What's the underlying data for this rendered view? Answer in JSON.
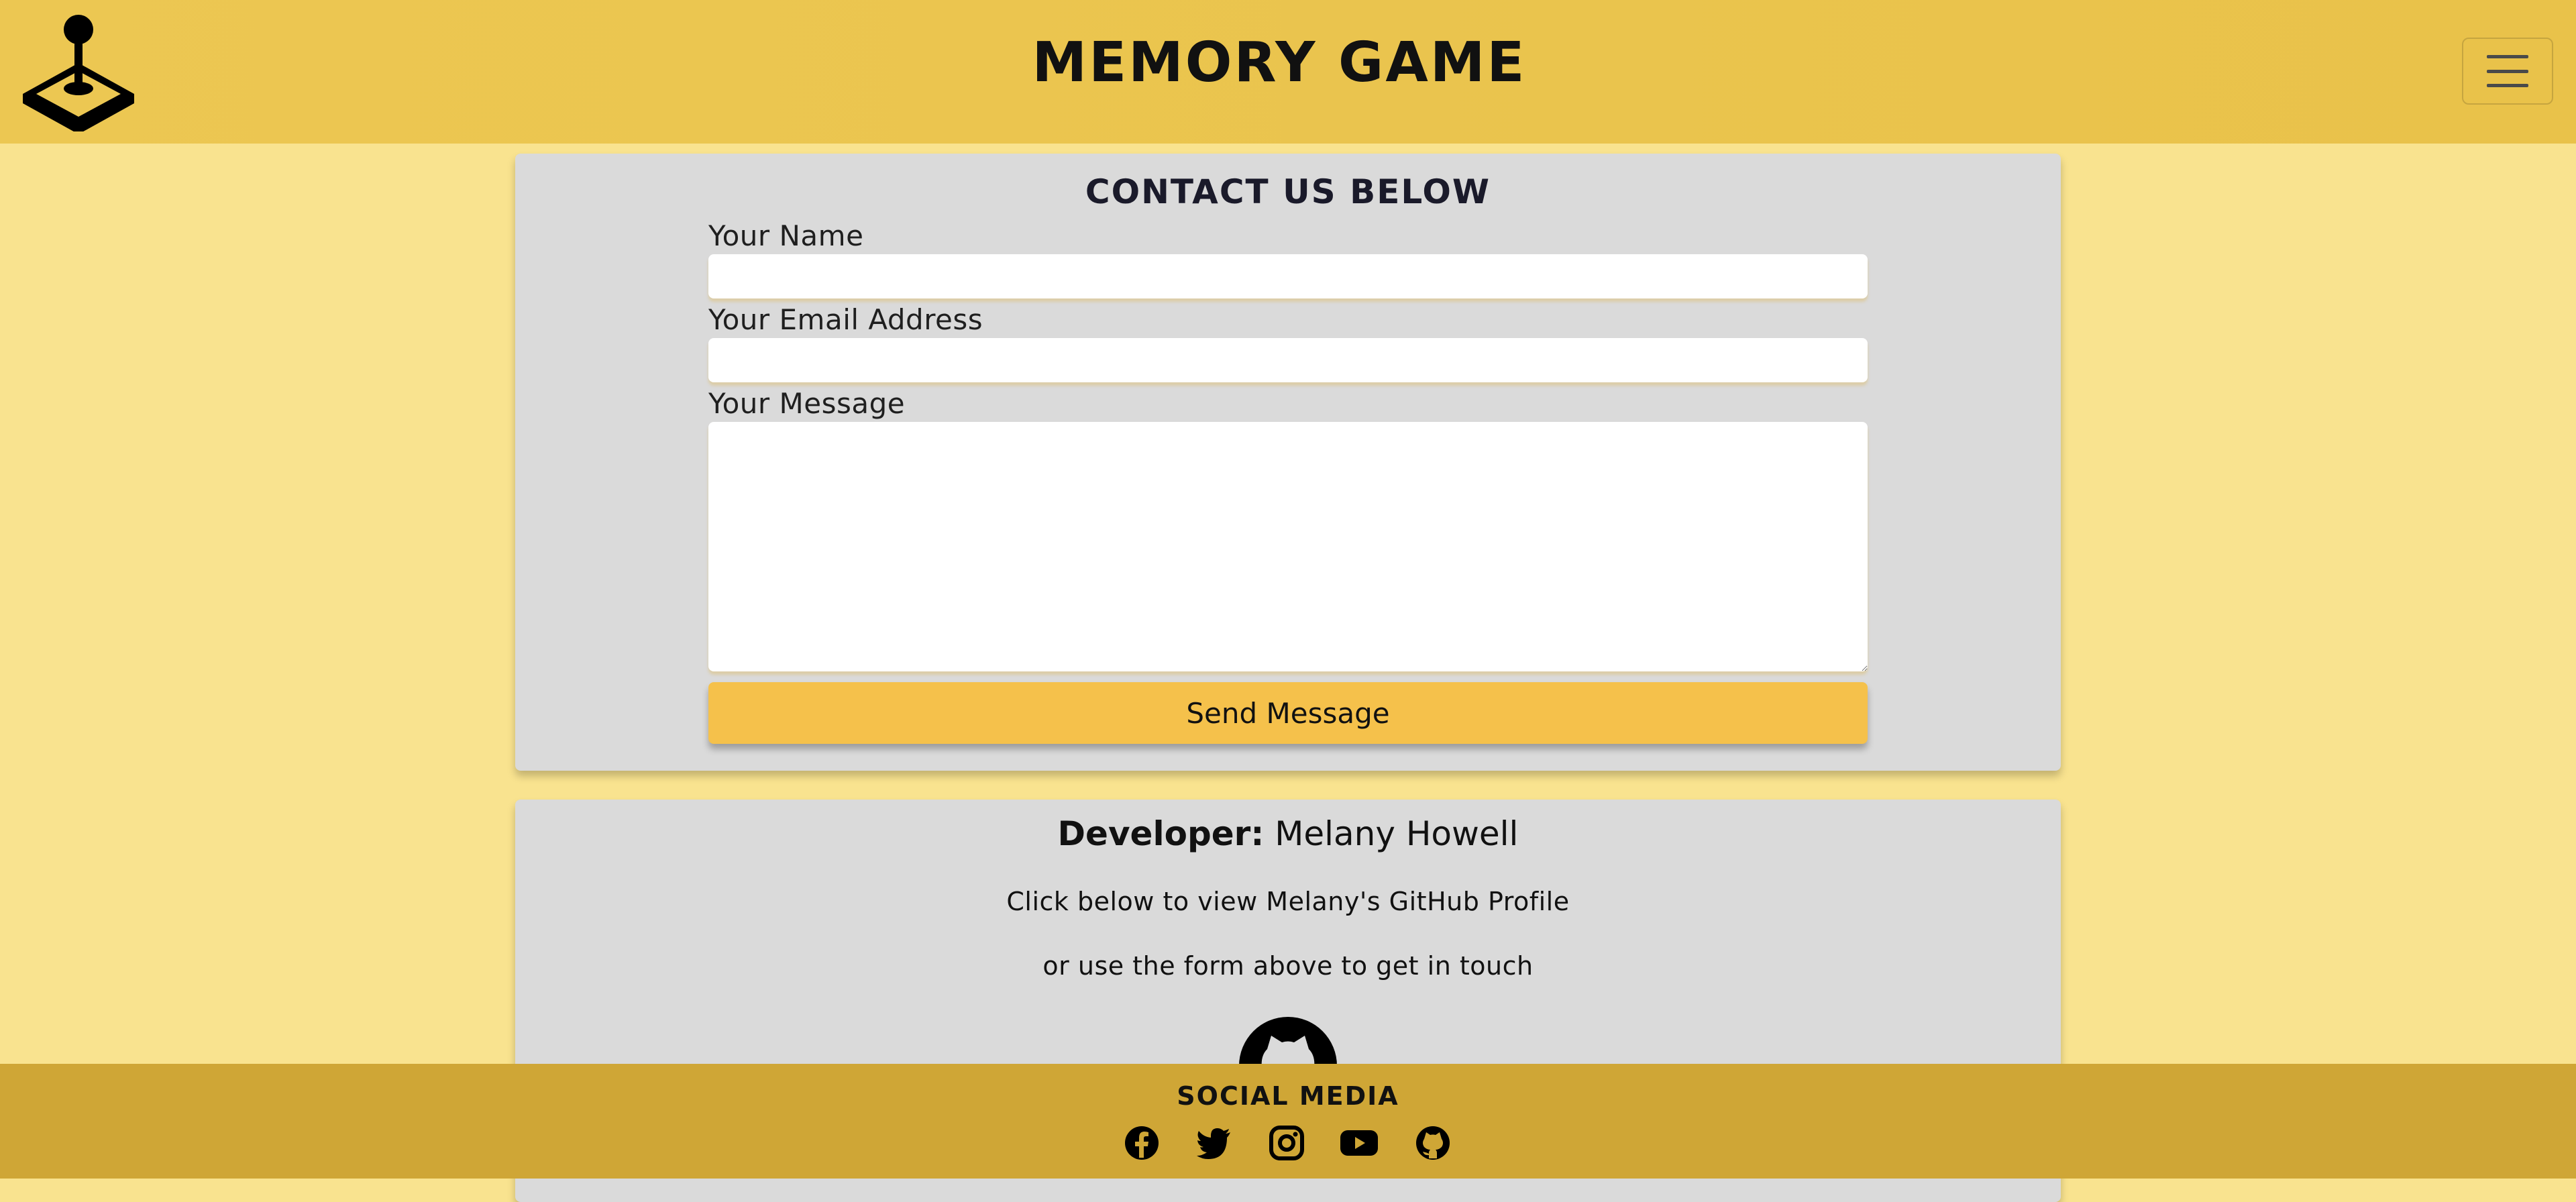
{
  "header": {
    "title": "MEMORY GAME",
    "logo_icon": "joystick-icon",
    "menu_icon": "hamburger-menu-icon"
  },
  "contact": {
    "heading": "CONTACT US BELOW",
    "name_label": "Your Name",
    "name_value": "",
    "email_label": "Your Email Address",
    "email_value": "",
    "message_label": "Your Message",
    "message_value": "",
    "send_label": "Send Message"
  },
  "developer": {
    "label": "Developer:",
    "name": "Melany Howell",
    "line1": "Click below to view Melany's GitHub Profile",
    "line2": "or use the form above to get in touch",
    "link_icon": "github-icon"
  },
  "footer": {
    "title": "SOCIAL MEDIA",
    "icons": [
      "facebook-icon",
      "twitter-icon",
      "instagram-icon",
      "youtube-icon",
      "github-icon"
    ]
  },
  "colors": {
    "header_bg": "#e9c24a",
    "page_bg": "#f9e38f",
    "card_bg": "#dadada",
    "button_bg": "#f5c14b",
    "footer_bg": "#cfa636"
  }
}
